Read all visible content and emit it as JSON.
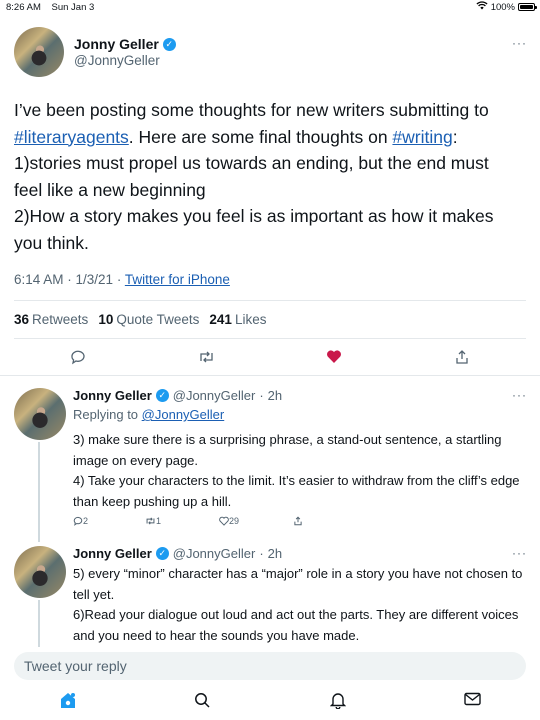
{
  "status_bar": {
    "time": "8:26 AM",
    "date": "Sun Jan 3",
    "battery": "100%"
  },
  "main_tweet": {
    "name": "Jonny Geller",
    "handle": "@JonnyGeller",
    "text_1": "I’ve been posting some thoughts for new writers submitting to ",
    "hashtag_1": "#literaryagents",
    "text_2": ". Here are some final thoughts on ",
    "hashtag_2": "#writing",
    "text_3": ":",
    "line_3": "1)stories must propel us towards an ending, but the end must feel like a new beginning",
    "line_4": "2)How a story makes you feel is as important as how it makes you think.",
    "time": "6:14 AM",
    "date": "1/3/21",
    "source": "Twitter for iPhone",
    "retweets_count": "36",
    "retweets_label": "Retweets",
    "quotes_count": "10",
    "quotes_label": "Quote Tweets",
    "likes_count": "241",
    "likes_label": "Likes",
    "more": "···"
  },
  "replies": [
    {
      "name": "Jonny Geller",
      "handle": "@JonnyGeller",
      "age": "2h",
      "replying_prefix": "Replying to ",
      "replying_to": "@JonnyGeller",
      "line_1": "3) make sure there is a surprising phrase, a stand-out sentence, a startling image on every page.",
      "line_2": "4) Take your characters to the limit. It’s easier to withdraw from the cliff’s edge than keep pushing up a hill.",
      "reply_count": "2",
      "retweet_count": "1",
      "like_count": "29"
    },
    {
      "name": "Jonny Geller",
      "handle": "@JonnyGeller",
      "age": "2h",
      "line_1": "5) every “minor” character has a “major” role in a story you have not chosen to tell yet.",
      "line_2": "6)Read your dialogue out loud and act out the parts. They are different voices and you need to hear the sounds you have made."
    }
  ],
  "composer": {
    "placeholder": "Tweet your reply"
  },
  "colors": {
    "accent": "#1d9bf0",
    "link": "#1b5fb3",
    "like": "#c9184a"
  }
}
